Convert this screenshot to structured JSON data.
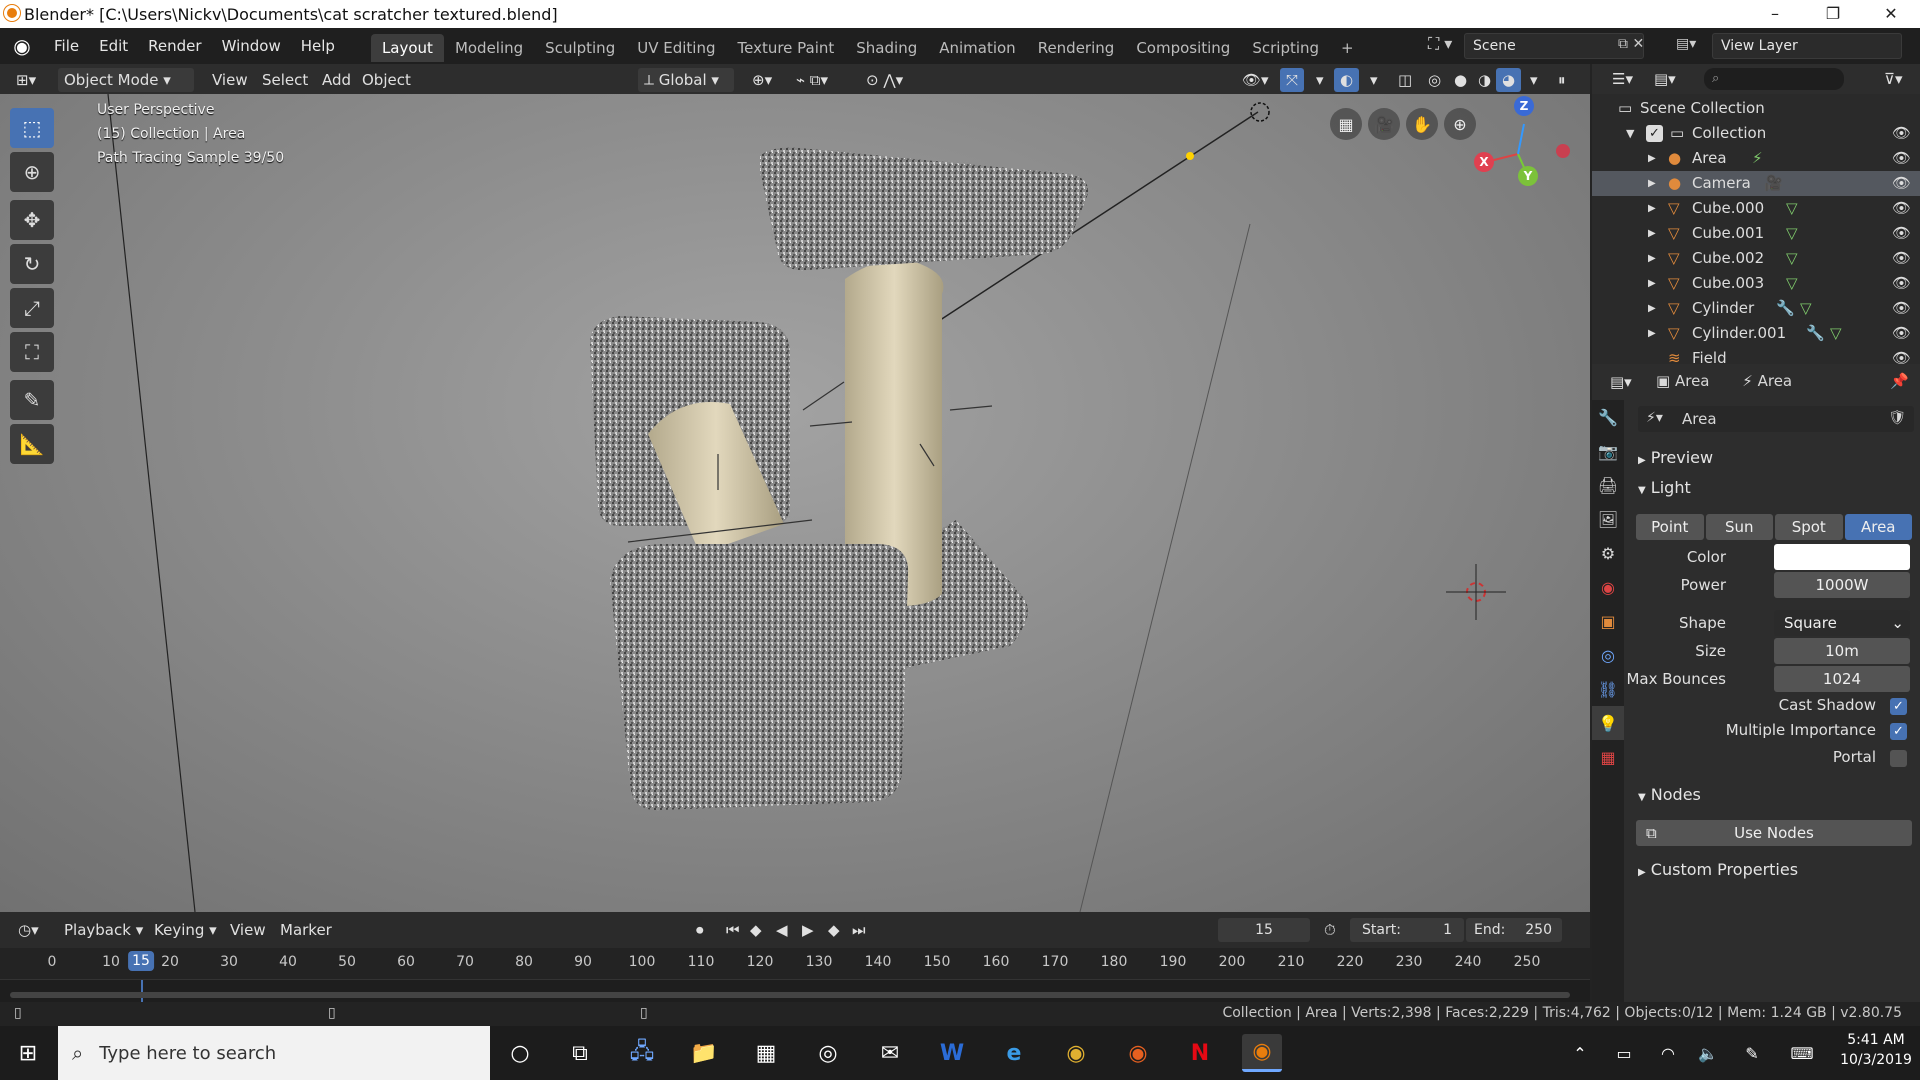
{
  "window": {
    "title": "Blender* [C:\\Users\\Nickv\\Documents\\cat scratcher textured.blend]",
    "minimize": "–",
    "restore": "❐",
    "close": "✕"
  },
  "menu": [
    "File",
    "Edit",
    "Render",
    "Window",
    "Help"
  ],
  "workspaces": [
    "Layout",
    "Modeling",
    "Sculpting",
    "UV Editing",
    "Texture Paint",
    "Shading",
    "Animation",
    "Rendering",
    "Compositing",
    "Scripting",
    "+"
  ],
  "active_workspace": "Layout",
  "scene": "Scene",
  "view_layer": "View Layer",
  "viewport_header": {
    "mode": "Object Mode",
    "view": "View",
    "select": "Select",
    "add": "Add",
    "object": "Object",
    "orientation": "Global"
  },
  "viewport": {
    "line1": "User Perspective",
    "line2": "(15) Collection | Area",
    "line3": "Path Tracing Sample 39/50",
    "gizmo": {
      "x": "X",
      "y": "Y",
      "z": "Z"
    }
  },
  "outliner": {
    "root": "Scene Collection",
    "collection": "Collection",
    "items": [
      "Area",
      "Camera",
      "Cube.000",
      "Cube.001",
      "Cube.002",
      "Cube.003",
      "Cylinder",
      "Cylinder.001",
      "Field"
    ],
    "selected": "Camera"
  },
  "properties": {
    "crumb1": "Area",
    "crumb2": "Area",
    "datablock": "Area",
    "panels": {
      "preview": "Preview",
      "light": "Light",
      "nodes": "Nodes",
      "custom": "Custom Properties"
    },
    "light_types": [
      "Point",
      "Sun",
      "Spot",
      "Area"
    ],
    "active_type": "Area",
    "color_label": "Color",
    "color_value": "#ffffff",
    "power_label": "Power",
    "power": "1000W",
    "shape_label": "Shape",
    "shape": "Square",
    "size_label": "Size",
    "size": "10m",
    "bounces_label": "Max Bounces",
    "bounces": "1024",
    "cast_shadow": "Cast Shadow",
    "multiple_importance": "Multiple Importance",
    "portal": "Portal",
    "use_nodes": "Use Nodes"
  },
  "timeline": {
    "menus": [
      "Playback",
      "Keying",
      "View",
      "Marker"
    ],
    "current_frame": "15",
    "start_label": "Start:",
    "start": "1",
    "end_label": "End:",
    "end": "250",
    "ticks": [
      "0",
      "10",
      "15",
      "20",
      "30",
      "40",
      "50",
      "60",
      "70",
      "80",
      "90",
      "100",
      "110",
      "120",
      "130",
      "140",
      "150",
      "160",
      "170",
      "180",
      "190",
      "200",
      "210",
      "220",
      "230",
      "240",
      "250"
    ]
  },
  "status": "Collection | Area | Verts:2,398 | Faces:2,229 | Tris:4,762 | Objects:0/12 | Mem: 1.24 GB | v2.80.75",
  "taskbar": {
    "search_placeholder": "Type here to search",
    "time": "5:41 AM",
    "date": "10/3/2019"
  },
  "colors": {
    "accent": "#4772b3",
    "selected_row": "#54585f",
    "light_icon": "#7ec86b",
    "mesh_icon": "#e08a3c"
  }
}
